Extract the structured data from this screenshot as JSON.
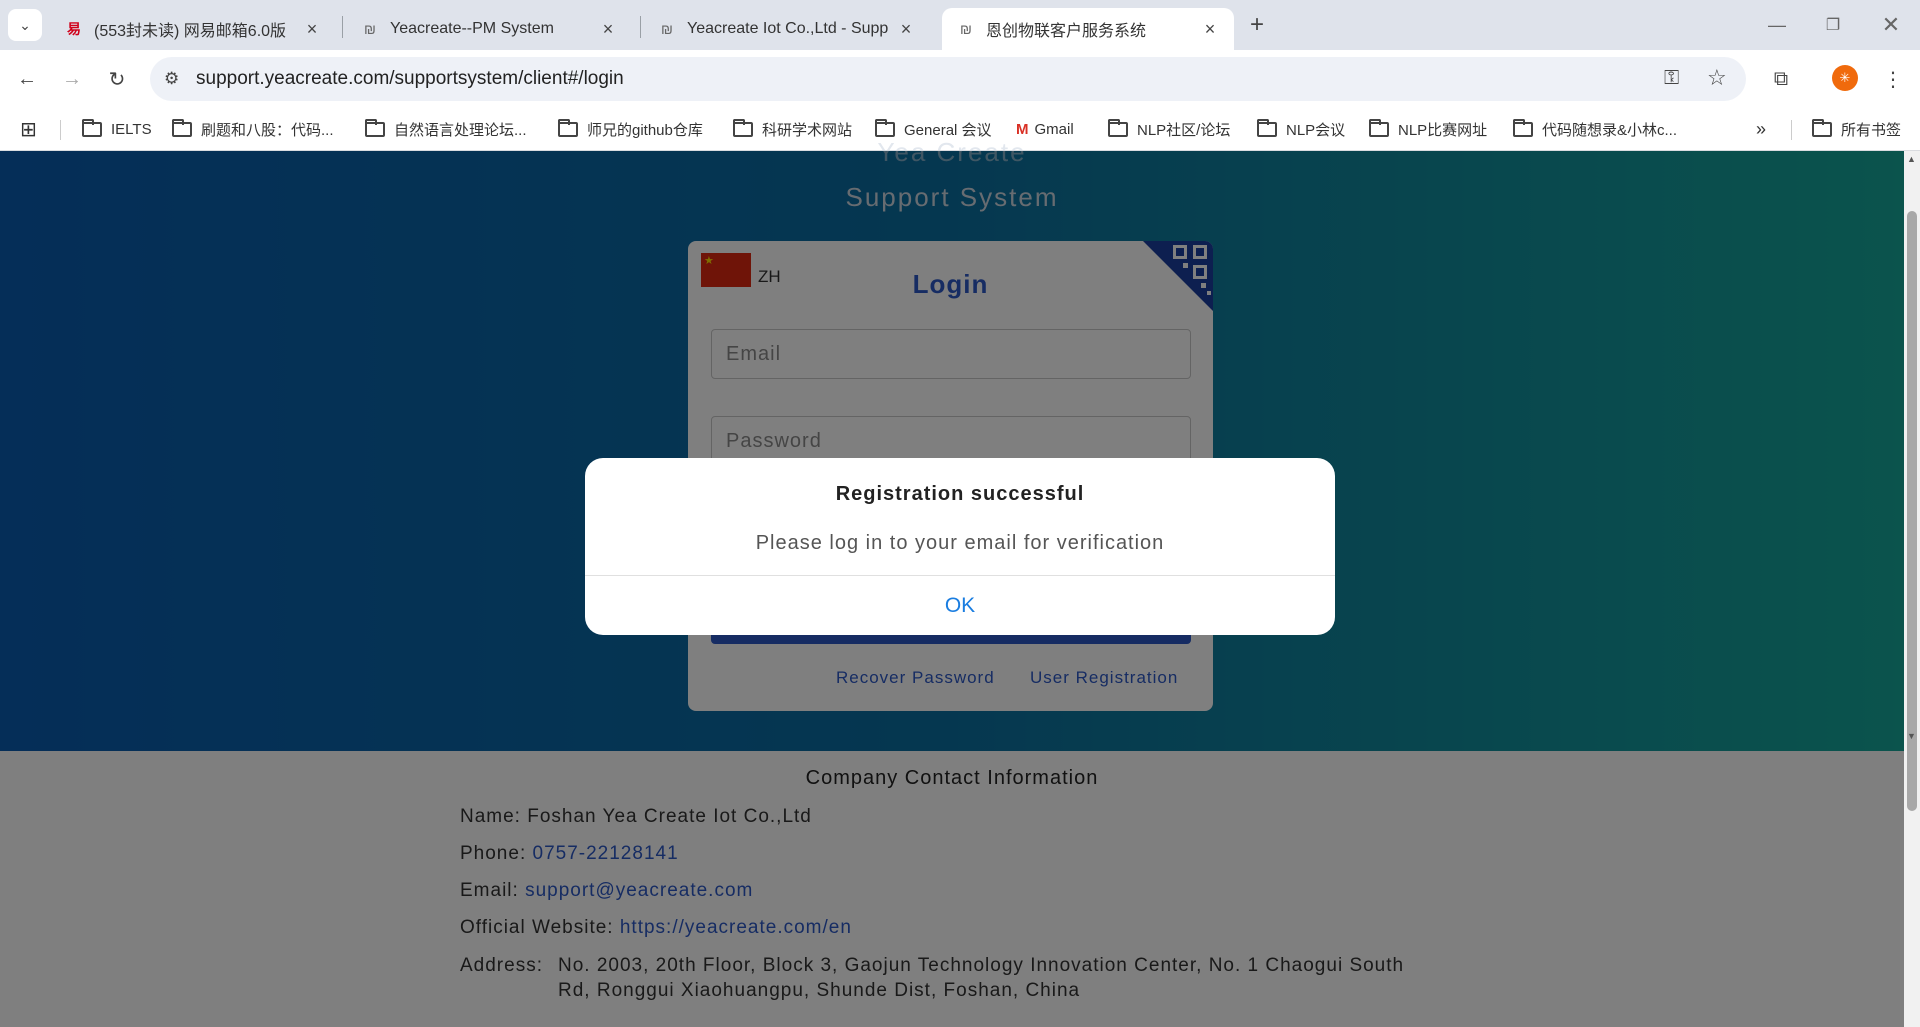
{
  "tabs": [
    {
      "title": "(553封未读) 网易邮箱6.0版",
      "icon": "netease-mail-icon"
    },
    {
      "title": "Yeacreate--PM System",
      "icon": "yeacreate-logo-icon"
    },
    {
      "title": "Yeacreate Iot Co.,Ltd - Suppo",
      "icon": "yeacreate-logo-icon"
    },
    {
      "title": "恩创物联客户服务系统",
      "icon": "yeacreate-logo-icon",
      "active": true
    }
  ],
  "new_tab": "+",
  "address_bar": {
    "url": "support.yeacreate.com/supportsystem/client#/login"
  },
  "bookmarks": [
    {
      "label": "IELTS"
    },
    {
      "label": "刷题和八股：代码..."
    },
    {
      "label": "自然语言处理论坛..."
    },
    {
      "label": "师兄的github仓库"
    },
    {
      "label": "科研学术网站"
    },
    {
      "label": "General 会议"
    },
    {
      "label": "Gmail"
    },
    {
      "label": "NLP社区/论坛"
    },
    {
      "label": "NLP会议"
    },
    {
      "label": "NLP比赛网址"
    },
    {
      "label": "代码随想录&小林c..."
    }
  ],
  "all_bookmarks": "所有书签",
  "site": {
    "brand": "Yea Create",
    "subtitle": "Support System"
  },
  "login": {
    "lang": "ZH",
    "title": "Login",
    "email_placeholder": "Email",
    "password_placeholder": "Password",
    "recover": "Recover Password",
    "register": "User Registration"
  },
  "footer": {
    "heading": "Company Contact Information",
    "name_label": "Name:",
    "name_value": "Foshan Yea Create Iot Co.,Ltd",
    "phone_label": "Phone:",
    "phone_value": "0757-22128141",
    "email_label": "Email:",
    "email_value": "support@yeacreate.com",
    "website_label": "Official Website:",
    "website_value": "https://yeacreate.com/en",
    "address_label": "Address:",
    "address_line1": "No. 2003, 20th Floor, Block 3, Gaojun Technology Innovation Center, No. 1 Chaogui South",
    "address_line2": "Rd, Ronggui Xiaohuangpu, Shunde Dist, Foshan, China"
  },
  "dialog": {
    "title": "Registration successful",
    "message": "Please log in to your email for verification",
    "ok": "OK"
  },
  "colors": {
    "accent_link": "#2c58c6",
    "dialog_button": "#1a7de0",
    "page_gradient_start": "#0a5cb0",
    "page_gradient_end": "#16a89a"
  }
}
